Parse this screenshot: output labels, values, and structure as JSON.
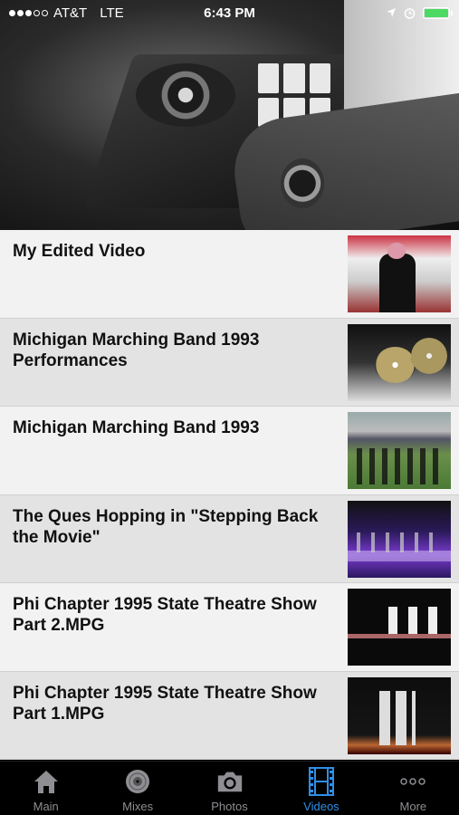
{
  "status_bar": {
    "carrier": "AT&T",
    "network": "LTE",
    "time": "6:43 PM",
    "signal_dots_filled": 3,
    "signal_dots_total": 5,
    "battery_color": "#4cd964"
  },
  "videos": [
    {
      "title": "My Edited Video"
    },
    {
      "title": "Michigan Marching Band 1993 Performances"
    },
    {
      "title": "Michigan Marching Band 1993"
    },
    {
      "title": "The Ques Hopping in \"Stepping Back the Movie\""
    },
    {
      "title": "Phi Chapter 1995 State Theatre Show Part 2.MPG"
    },
    {
      "title": "Phi Chapter 1995 State Theatre Show Part 1.MPG"
    }
  ],
  "tabs": [
    {
      "label": "Main",
      "icon": "home-icon"
    },
    {
      "label": "Mixes",
      "icon": "vinyl-icon"
    },
    {
      "label": "Photos",
      "icon": "camera-icon"
    },
    {
      "label": "Videos",
      "icon": "film-icon",
      "active": true
    },
    {
      "label": "More",
      "icon": "more-icon"
    }
  ],
  "colors": {
    "active_tab": "#2f8fe8",
    "inactive_tab": "#8e8e93"
  }
}
